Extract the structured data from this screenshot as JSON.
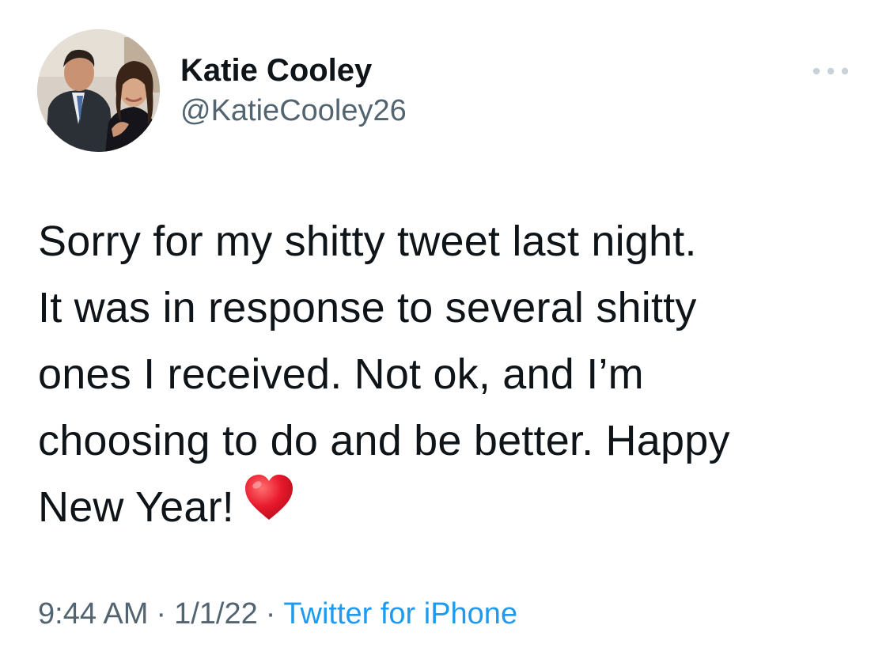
{
  "author": {
    "display_name": "Katie Cooley",
    "handle": "@KatieCooley26"
  },
  "tweet": {
    "lines": [
      "Sorry for my shitty tweet last night.",
      "It was in response to several shitty",
      "ones I received. Not ok, and I’m",
      "choosing to do and be better. Happy",
      "New Year!"
    ],
    "trailing_emoji": "red-heart-emoji"
  },
  "meta": {
    "time": "9:44 AM",
    "separator": "·",
    "date": "1/1/22",
    "source": "Twitter for iPhone"
  },
  "icons": {
    "more": "more-horizontal-icon"
  },
  "colors": {
    "text_primary": "#0f1419",
    "text_secondary": "#536471",
    "link": "#1d9bf0",
    "heart": "#e8192c",
    "more_icon": "#c9d1d9"
  }
}
